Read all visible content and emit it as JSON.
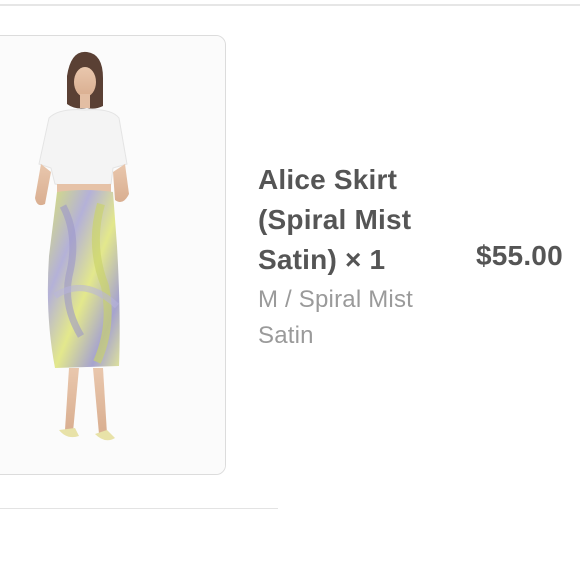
{
  "line_item": {
    "title_line1": "Alice Skirt",
    "title_line2": "(Spiral Mist",
    "title_line3": "Satin) × 1",
    "variant_line1": "M / Spiral Mist",
    "variant_line2": "Satin",
    "price": "$55.00",
    "image_subject": "model-in-white-crop-top-and-spiral-satin-skirt"
  },
  "colors": {
    "text_primary": "#555555",
    "text_secondary": "#9a9a9a",
    "divider": "#e6e6e6",
    "skirt_yellow": "#d9e07a",
    "skirt_lavender": "#a9a6d2"
  }
}
